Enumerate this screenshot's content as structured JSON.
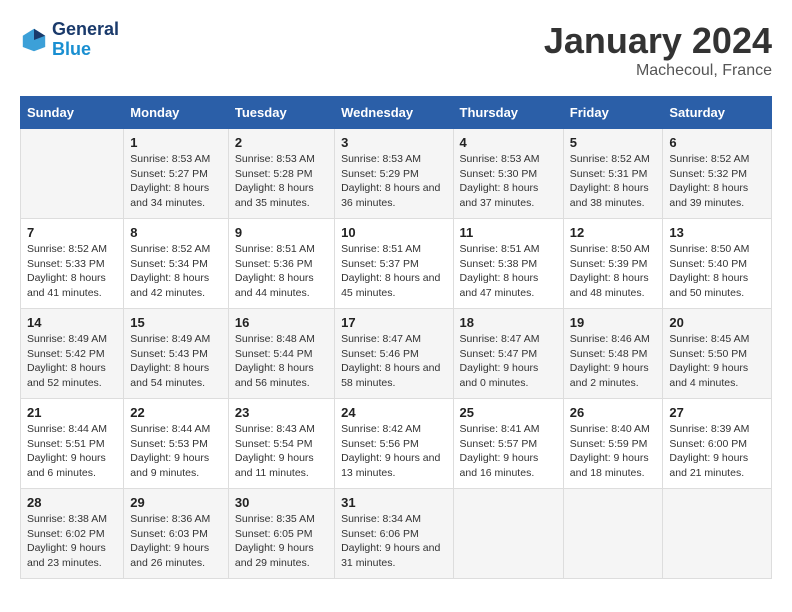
{
  "header": {
    "logo_line1": "General",
    "logo_line2": "Blue",
    "month": "January 2024",
    "location": "Machecoul, France"
  },
  "weekdays": [
    "Sunday",
    "Monday",
    "Tuesday",
    "Wednesday",
    "Thursday",
    "Friday",
    "Saturday"
  ],
  "weeks": [
    [
      {
        "day": "",
        "sunrise": "",
        "sunset": "",
        "daylight": ""
      },
      {
        "day": "1",
        "sunrise": "Sunrise: 8:53 AM",
        "sunset": "Sunset: 5:27 PM",
        "daylight": "Daylight: 8 hours and 34 minutes."
      },
      {
        "day": "2",
        "sunrise": "Sunrise: 8:53 AM",
        "sunset": "Sunset: 5:28 PM",
        "daylight": "Daylight: 8 hours and 35 minutes."
      },
      {
        "day": "3",
        "sunrise": "Sunrise: 8:53 AM",
        "sunset": "Sunset: 5:29 PM",
        "daylight": "Daylight: 8 hours and 36 minutes."
      },
      {
        "day": "4",
        "sunrise": "Sunrise: 8:53 AM",
        "sunset": "Sunset: 5:30 PM",
        "daylight": "Daylight: 8 hours and 37 minutes."
      },
      {
        "day": "5",
        "sunrise": "Sunrise: 8:52 AM",
        "sunset": "Sunset: 5:31 PM",
        "daylight": "Daylight: 8 hours and 38 minutes."
      },
      {
        "day": "6",
        "sunrise": "Sunrise: 8:52 AM",
        "sunset": "Sunset: 5:32 PM",
        "daylight": "Daylight: 8 hours and 39 minutes."
      }
    ],
    [
      {
        "day": "7",
        "sunrise": "Sunrise: 8:52 AM",
        "sunset": "Sunset: 5:33 PM",
        "daylight": "Daylight: 8 hours and 41 minutes."
      },
      {
        "day": "8",
        "sunrise": "Sunrise: 8:52 AM",
        "sunset": "Sunset: 5:34 PM",
        "daylight": "Daylight: 8 hours and 42 minutes."
      },
      {
        "day": "9",
        "sunrise": "Sunrise: 8:51 AM",
        "sunset": "Sunset: 5:36 PM",
        "daylight": "Daylight: 8 hours and 44 minutes."
      },
      {
        "day": "10",
        "sunrise": "Sunrise: 8:51 AM",
        "sunset": "Sunset: 5:37 PM",
        "daylight": "Daylight: 8 hours and 45 minutes."
      },
      {
        "day": "11",
        "sunrise": "Sunrise: 8:51 AM",
        "sunset": "Sunset: 5:38 PM",
        "daylight": "Daylight: 8 hours and 47 minutes."
      },
      {
        "day": "12",
        "sunrise": "Sunrise: 8:50 AM",
        "sunset": "Sunset: 5:39 PM",
        "daylight": "Daylight: 8 hours and 48 minutes."
      },
      {
        "day": "13",
        "sunrise": "Sunrise: 8:50 AM",
        "sunset": "Sunset: 5:40 PM",
        "daylight": "Daylight: 8 hours and 50 minutes."
      }
    ],
    [
      {
        "day": "14",
        "sunrise": "Sunrise: 8:49 AM",
        "sunset": "Sunset: 5:42 PM",
        "daylight": "Daylight: 8 hours and 52 minutes."
      },
      {
        "day": "15",
        "sunrise": "Sunrise: 8:49 AM",
        "sunset": "Sunset: 5:43 PM",
        "daylight": "Daylight: 8 hours and 54 minutes."
      },
      {
        "day": "16",
        "sunrise": "Sunrise: 8:48 AM",
        "sunset": "Sunset: 5:44 PM",
        "daylight": "Daylight: 8 hours and 56 minutes."
      },
      {
        "day": "17",
        "sunrise": "Sunrise: 8:47 AM",
        "sunset": "Sunset: 5:46 PM",
        "daylight": "Daylight: 8 hours and 58 minutes."
      },
      {
        "day": "18",
        "sunrise": "Sunrise: 8:47 AM",
        "sunset": "Sunset: 5:47 PM",
        "daylight": "Daylight: 9 hours and 0 minutes."
      },
      {
        "day": "19",
        "sunrise": "Sunrise: 8:46 AM",
        "sunset": "Sunset: 5:48 PM",
        "daylight": "Daylight: 9 hours and 2 minutes."
      },
      {
        "day": "20",
        "sunrise": "Sunrise: 8:45 AM",
        "sunset": "Sunset: 5:50 PM",
        "daylight": "Daylight: 9 hours and 4 minutes."
      }
    ],
    [
      {
        "day": "21",
        "sunrise": "Sunrise: 8:44 AM",
        "sunset": "Sunset: 5:51 PM",
        "daylight": "Daylight: 9 hours and 6 minutes."
      },
      {
        "day": "22",
        "sunrise": "Sunrise: 8:44 AM",
        "sunset": "Sunset: 5:53 PM",
        "daylight": "Daylight: 9 hours and 9 minutes."
      },
      {
        "day": "23",
        "sunrise": "Sunrise: 8:43 AM",
        "sunset": "Sunset: 5:54 PM",
        "daylight": "Daylight: 9 hours and 11 minutes."
      },
      {
        "day": "24",
        "sunrise": "Sunrise: 8:42 AM",
        "sunset": "Sunset: 5:56 PM",
        "daylight": "Daylight: 9 hours and 13 minutes."
      },
      {
        "day": "25",
        "sunrise": "Sunrise: 8:41 AM",
        "sunset": "Sunset: 5:57 PM",
        "daylight": "Daylight: 9 hours and 16 minutes."
      },
      {
        "day": "26",
        "sunrise": "Sunrise: 8:40 AM",
        "sunset": "Sunset: 5:59 PM",
        "daylight": "Daylight: 9 hours and 18 minutes."
      },
      {
        "day": "27",
        "sunrise": "Sunrise: 8:39 AM",
        "sunset": "Sunset: 6:00 PM",
        "daylight": "Daylight: 9 hours and 21 minutes."
      }
    ],
    [
      {
        "day": "28",
        "sunrise": "Sunrise: 8:38 AM",
        "sunset": "Sunset: 6:02 PM",
        "daylight": "Daylight: 9 hours and 23 minutes."
      },
      {
        "day": "29",
        "sunrise": "Sunrise: 8:36 AM",
        "sunset": "Sunset: 6:03 PM",
        "daylight": "Daylight: 9 hours and 26 minutes."
      },
      {
        "day": "30",
        "sunrise": "Sunrise: 8:35 AM",
        "sunset": "Sunset: 6:05 PM",
        "daylight": "Daylight: 9 hours and 29 minutes."
      },
      {
        "day": "31",
        "sunrise": "Sunrise: 8:34 AM",
        "sunset": "Sunset: 6:06 PM",
        "daylight": "Daylight: 9 hours and 31 minutes."
      },
      {
        "day": "",
        "sunrise": "",
        "sunset": "",
        "daylight": ""
      },
      {
        "day": "",
        "sunrise": "",
        "sunset": "",
        "daylight": ""
      },
      {
        "day": "",
        "sunrise": "",
        "sunset": "",
        "daylight": ""
      }
    ]
  ]
}
